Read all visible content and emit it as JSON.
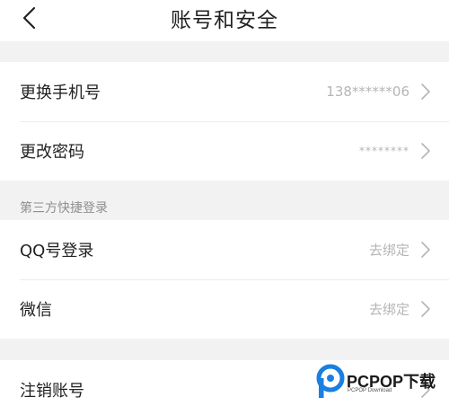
{
  "header": {
    "title": "账号和安全"
  },
  "account_group": [
    {
      "label": "更换手机号",
      "value": "138******06"
    },
    {
      "label": "更改密码",
      "value": "********"
    }
  ],
  "third_party": {
    "section_label": "第三方快捷登录",
    "items": [
      {
        "label": "QQ号登录",
        "value": "去绑定"
      },
      {
        "label": "微信",
        "value": "去绑定"
      }
    ]
  },
  "cancel_account": {
    "label": "注销账号"
  },
  "watermark": {
    "brand": "PCPOP下载",
    "sub": "PCPOP Download"
  },
  "colors": {
    "accent": "#1a7fe0",
    "muted": "#b5b5b5",
    "background": "#f2f2f2"
  },
  "icons": {
    "back": "chevron-left-icon",
    "row_arrow": "chevron-right-icon"
  }
}
